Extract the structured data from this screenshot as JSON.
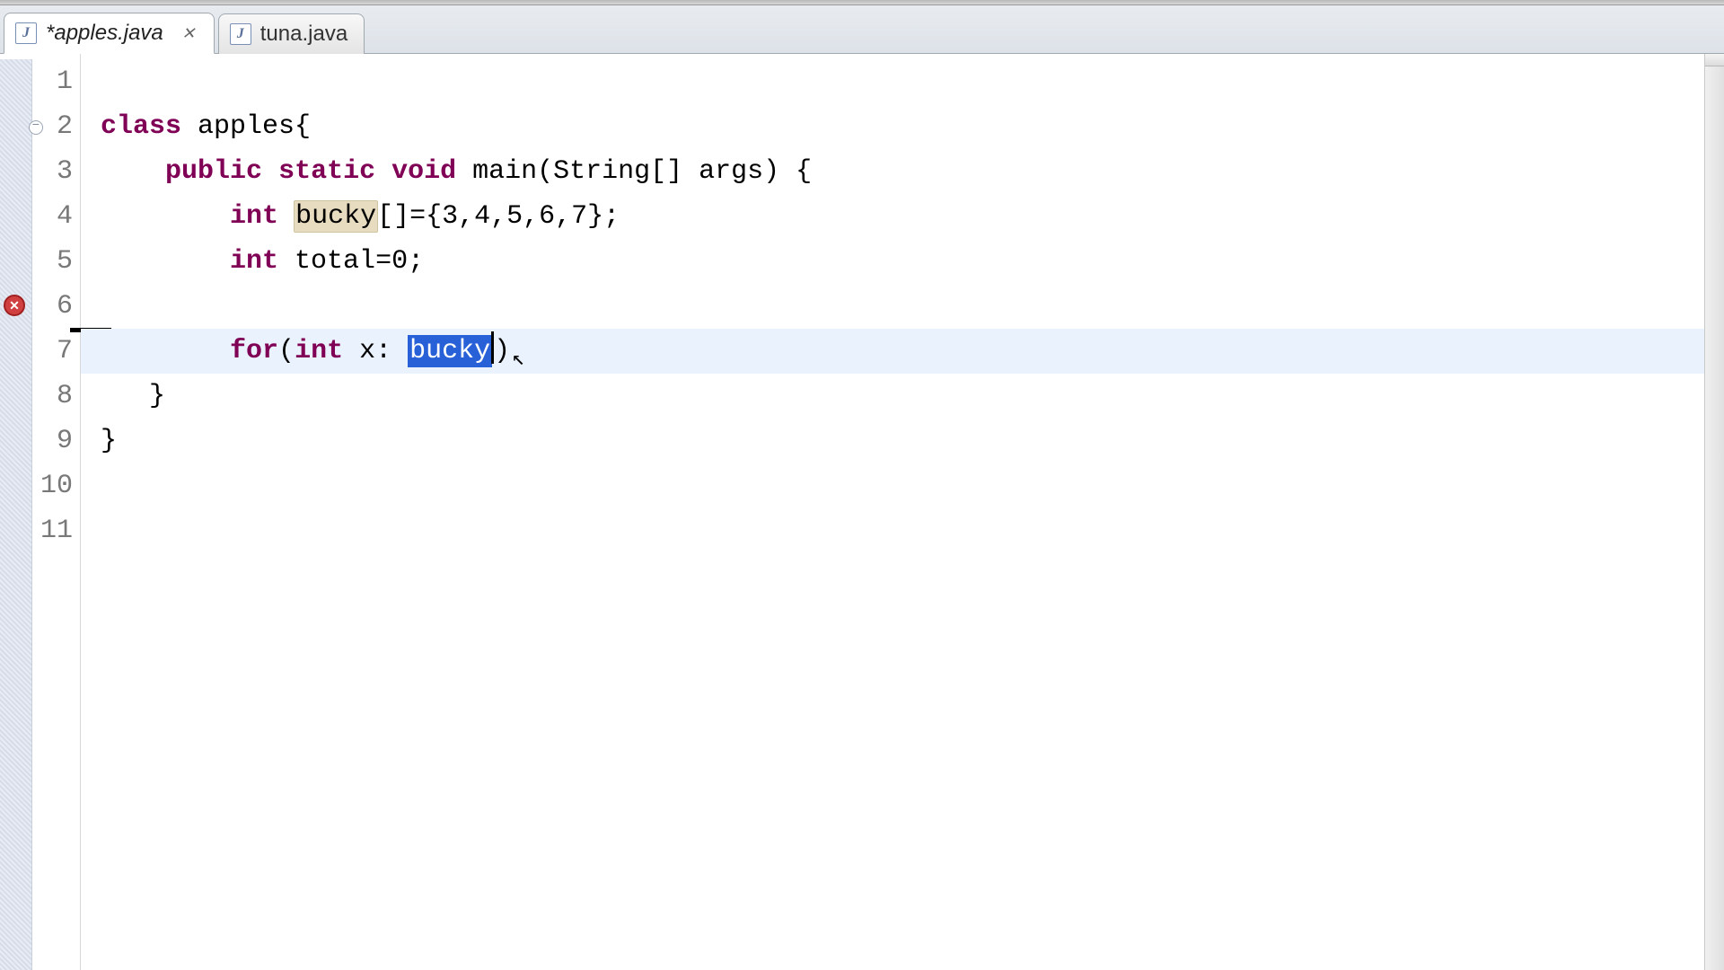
{
  "tabs": [
    {
      "icon": "J",
      "label": "*apples.java",
      "active": true,
      "closable": true
    },
    {
      "icon": "J",
      "label": "tuna.java",
      "active": false,
      "closable": false
    }
  ],
  "editor": {
    "line_count": 11,
    "current_line": 6,
    "error_line": 6,
    "foldable_line": 2,
    "tokens": {
      "kw_class": "class",
      "cls_name": " apples{",
      "kw_public": "public",
      "kw_static": "static",
      "kw_void": "void",
      "main_sig": " main(String[] args) {",
      "kw_int1": "int",
      "sp1": " ",
      "bucky_decl": "bucky",
      "arr_init": "[]={3,4,5,6,7};",
      "kw_int2": "int",
      "total_decl": " total=0;",
      "kw_for": "for",
      "for_open": "(",
      "kw_int3": "int",
      "for_var": " x: ",
      "bucky_sel": "bucky",
      "for_close": ")",
      "close_inner": "   }",
      "close_outer": "}"
    }
  }
}
